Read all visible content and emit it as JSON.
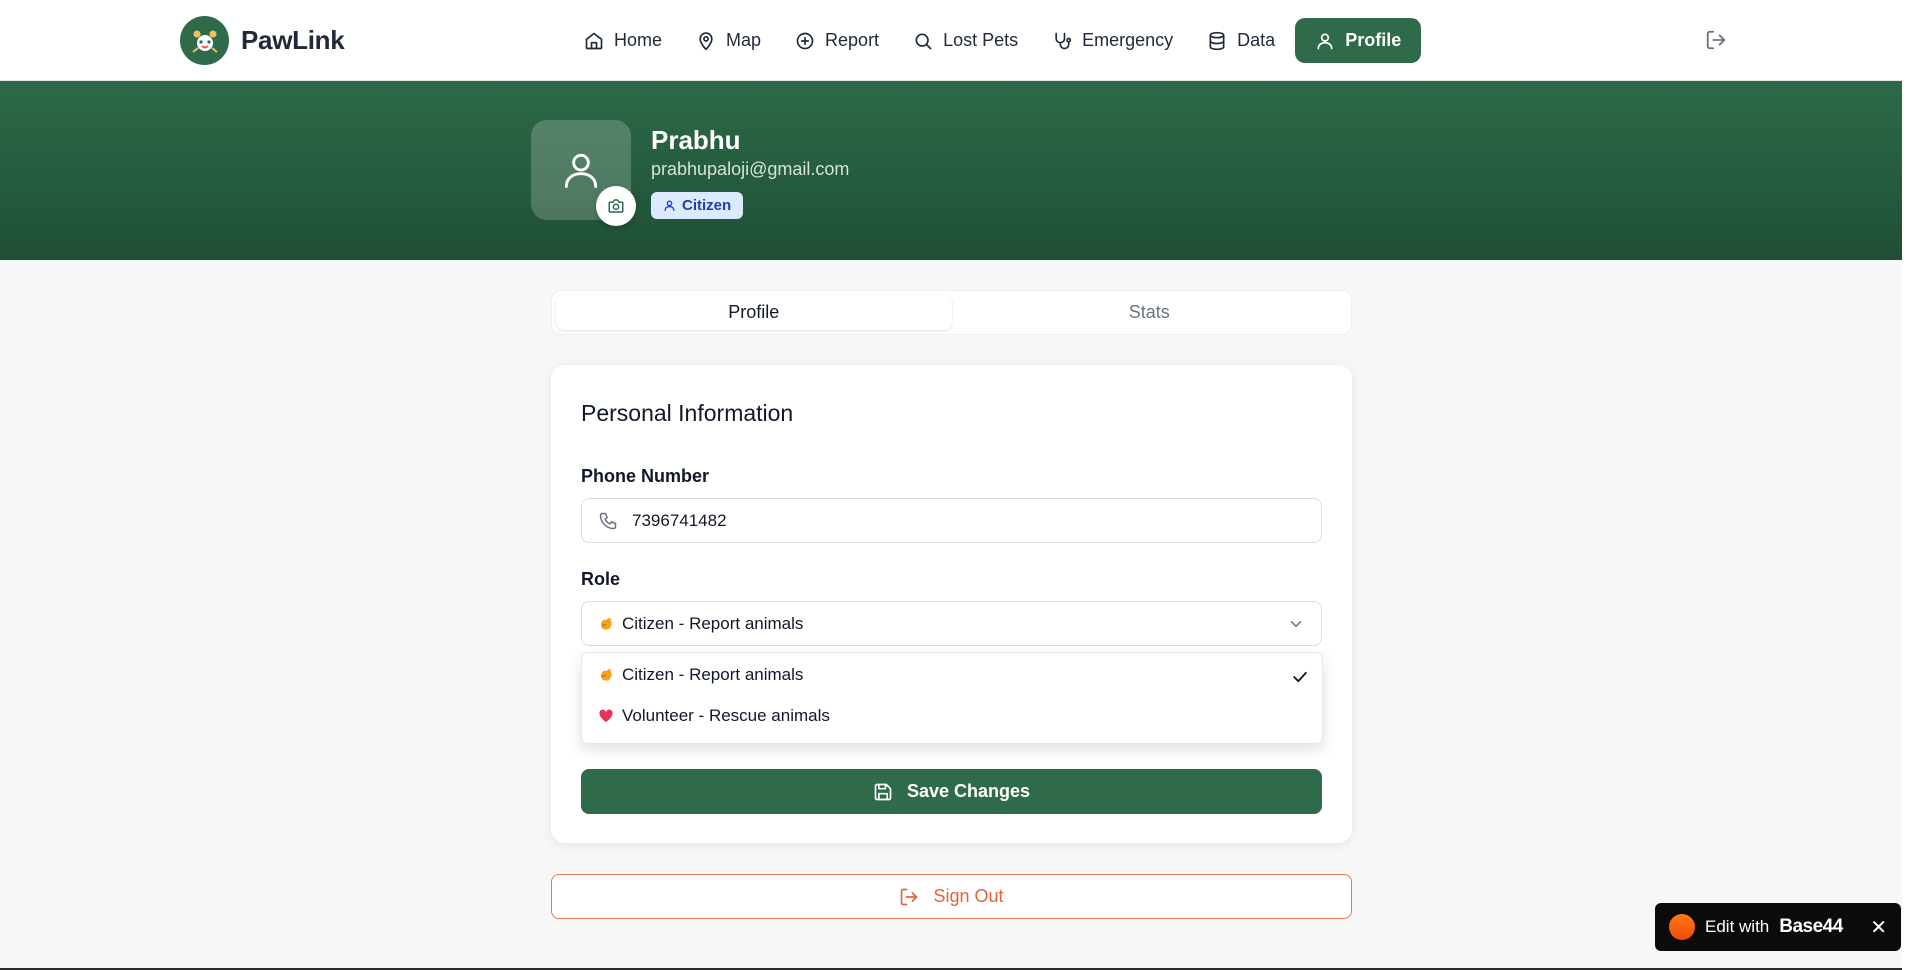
{
  "brand": {
    "name": "PawLink"
  },
  "nav": {
    "items": [
      {
        "label": "Home",
        "icon": "home-icon"
      },
      {
        "label": "Map",
        "icon": "map-pin-icon"
      },
      {
        "label": "Report",
        "icon": "plus-circle-icon"
      },
      {
        "label": "Lost Pets",
        "icon": "search-icon"
      },
      {
        "label": "Emergency",
        "icon": "stethoscope-icon"
      },
      {
        "label": "Data",
        "icon": "database-icon"
      },
      {
        "label": "Profile",
        "icon": "user-icon",
        "active": true
      }
    ]
  },
  "profile": {
    "name": "Prabhu",
    "email": "prabhupaloji@gmail.com",
    "role_badge": "Citizen"
  },
  "tabs": [
    {
      "label": "Profile",
      "active": true
    },
    {
      "label": "Stats",
      "active": false
    }
  ],
  "form": {
    "title": "Personal Information",
    "phone_label": "Phone Number",
    "phone_value": "7396741482",
    "role_label": "Role",
    "role_selected": "Citizen - Report animals",
    "role_options": [
      {
        "label": "Citizen - Report animals",
        "selected": true
      },
      {
        "label": "Volunteer - Rescue animals",
        "selected": false
      }
    ],
    "save_label": "Save Changes"
  },
  "signout_label": "Sign Out",
  "base44": {
    "prefix": "Edit with",
    "brand": "Base44",
    "close": "✕"
  },
  "colors": {
    "primary": "#2f6b4b",
    "banner_dark": "#1f4f36",
    "signout": "#e0643f",
    "badge_bg": "#dbeafe",
    "badge_text": "#1e40af"
  }
}
